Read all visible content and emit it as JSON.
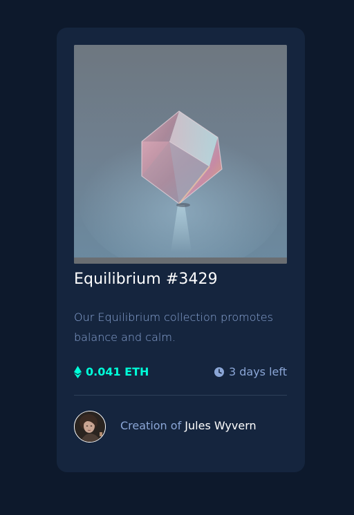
{
  "card": {
    "image_alt": "Equilibrium cube",
    "title": "Equilibrium #3429",
    "description": "Our Equilibrium collection promotes balance and calm.",
    "price": "0.041 ETH",
    "time_left": "3 days left",
    "creator_prefix": "Creation of",
    "creator_name": "Jules Wyvern"
  },
  "icons": {
    "price": "ethereum-icon",
    "time": "clock-icon"
  },
  "colors": {
    "page_bg": "#0d192c",
    "card_bg": "#15253e",
    "accent_cyan": "#00ffd9",
    "soft_blue": "#8ba6d6",
    "white": "#ffffff",
    "divider": "#2e405a"
  }
}
